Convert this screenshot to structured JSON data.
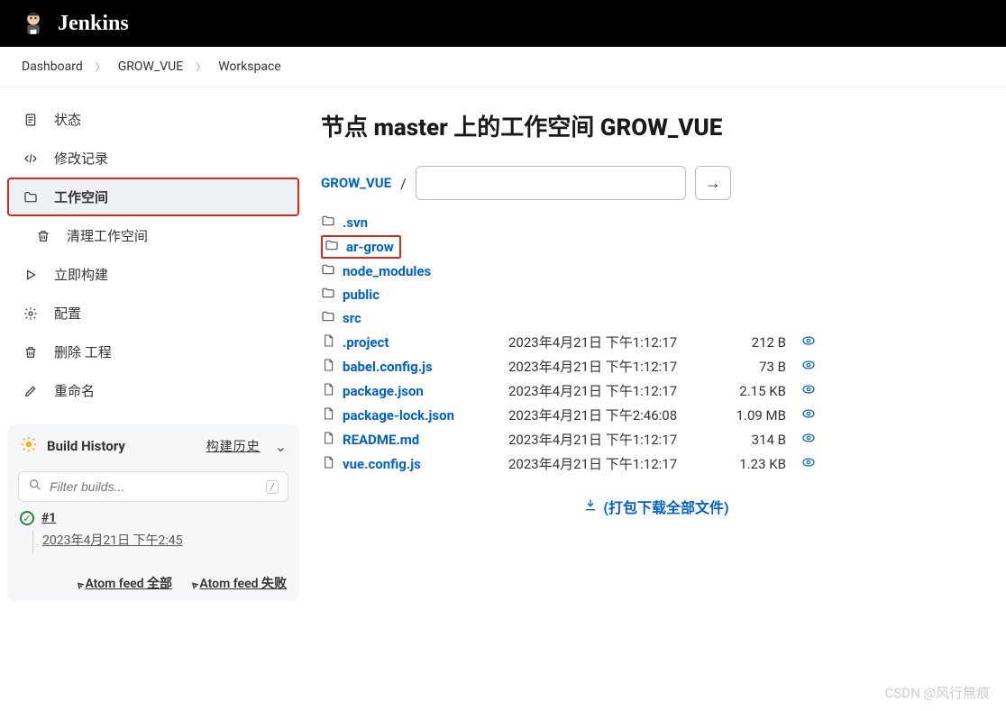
{
  "app": {
    "name": "Jenkins"
  },
  "breadcrumb": {
    "items": [
      "Dashboard",
      "GROW_VUE",
      "Workspace"
    ]
  },
  "sidebar": {
    "items": [
      {
        "label": "状态",
        "icon": "doc"
      },
      {
        "label": "修改记录",
        "icon": "xml"
      },
      {
        "label": "工作空间",
        "icon": "folder",
        "selected": true
      },
      {
        "label": "清理工作空间",
        "icon": "trash",
        "sub": true
      },
      {
        "label": "立即构建",
        "icon": "play"
      },
      {
        "label": "配置",
        "icon": "gear"
      },
      {
        "label": "删除 工程",
        "icon": "trash"
      },
      {
        "label": "重命名",
        "icon": "pencil"
      }
    ]
  },
  "build_history": {
    "title": "Build History",
    "trend_label": "构建历史",
    "search_placeholder": "Filter builds...",
    "build": {
      "num": "#1",
      "date": "2023年4月21日 下午2:45"
    },
    "feeds": {
      "all": "Atom feed 全部",
      "fail": "Atom feed 失败"
    }
  },
  "page": {
    "title": "节点 master 上的工作空间 GROW_VUE",
    "path_label": "GROW_VUE",
    "path_sep": "/"
  },
  "dirs": [
    {
      "name": ".svn"
    },
    {
      "name": "ar-grow",
      "highlight": true
    },
    {
      "name": "node_modules"
    },
    {
      "name": "public"
    },
    {
      "name": "src"
    }
  ],
  "files": [
    {
      "name": ".project",
      "date": "2023年4月21日 下午1:12:17",
      "size": "212 B"
    },
    {
      "name": "babel.config.js",
      "date": "2023年4月21日 下午1:12:17",
      "size": "73 B"
    },
    {
      "name": "package.json",
      "date": "2023年4月21日 下午1:12:17",
      "size": "2.15 KB"
    },
    {
      "name": "package-lock.json",
      "date": "2023年4月21日 下午2:46:08",
      "size": "1.09 MB"
    },
    {
      "name": "README.md",
      "date": "2023年4月21日 下午1:12:17",
      "size": "314 B"
    },
    {
      "name": "vue.config.js",
      "date": "2023年4月21日 下午1:12:17",
      "size": "1.23 KB"
    }
  ],
  "download_all": "(打包下载全部文件)",
  "watermark": "CSDN @风行無痕",
  "go_label": "→"
}
